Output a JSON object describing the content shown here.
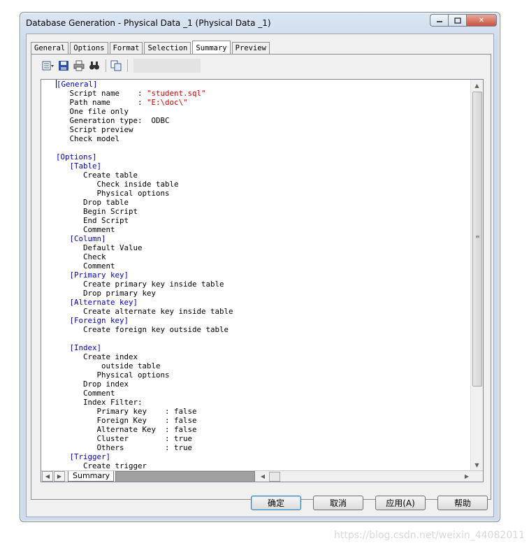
{
  "window": {
    "title": "Database Generation - Physical Data _1 (Physical Data _1)",
    "close_glyph": "✕"
  },
  "tabs": [
    {
      "label": "General"
    },
    {
      "label": "Options"
    },
    {
      "label": "Format"
    },
    {
      "label": "Selection"
    },
    {
      "label": "Summary",
      "active": true
    },
    {
      "label": "Preview"
    }
  ],
  "toolbar": {
    "icons": [
      "properties-icon",
      "save-icon",
      "print-icon",
      "find-icon",
      "copy-icon"
    ]
  },
  "summary_lines": [
    {
      "text": "[General]",
      "kind": "section",
      "indent": 0
    },
    {
      "text": "Script name    : ",
      "value": "\"student.sql\"",
      "indent": 3
    },
    {
      "text": "Path name      : ",
      "value": "\"E:\\doc\\\"",
      "indent": 3
    },
    {
      "text": "One file only",
      "indent": 3
    },
    {
      "text": "Generation type:  ODBC",
      "indent": 3
    },
    {
      "text": "Script preview",
      "indent": 3
    },
    {
      "text": "Check model",
      "indent": 3
    },
    {
      "text": "",
      "indent": 0
    },
    {
      "text": "[Options]",
      "kind": "section",
      "indent": 0
    },
    {
      "text": "[Table]",
      "kind": "section",
      "indent": 3
    },
    {
      "text": "Create table",
      "indent": 6
    },
    {
      "text": "Check inside table",
      "indent": 9
    },
    {
      "text": "Physical options",
      "indent": 9
    },
    {
      "text": "Drop table",
      "indent": 6
    },
    {
      "text": "Begin Script",
      "indent": 6
    },
    {
      "text": "End Script",
      "indent": 6
    },
    {
      "text": "Comment",
      "indent": 6
    },
    {
      "text": "[Column]",
      "kind": "section",
      "indent": 3
    },
    {
      "text": "Default Value",
      "indent": 6
    },
    {
      "text": "Check",
      "indent": 6
    },
    {
      "text": "Comment",
      "indent": 6
    },
    {
      "text": "[Primary key]",
      "kind": "section",
      "indent": 3
    },
    {
      "text": "Create primary key inside table",
      "indent": 6
    },
    {
      "text": "Drop primary key",
      "indent": 6
    },
    {
      "text": "[Alternate key]",
      "kind": "section",
      "indent": 3
    },
    {
      "text": "Create alternate key inside table",
      "indent": 6
    },
    {
      "text": "[Foreign key]",
      "kind": "section",
      "indent": 3
    },
    {
      "text": "Create foreign key outside table",
      "indent": 6
    },
    {
      "text": "",
      "indent": 0
    },
    {
      "text": "[Index]",
      "kind": "section",
      "indent": 3
    },
    {
      "text": "Create index",
      "indent": 6
    },
    {
      "text": "outside table",
      "indent": 10
    },
    {
      "text": "Physical options",
      "indent": 9
    },
    {
      "text": "Drop index",
      "indent": 6
    },
    {
      "text": "Comment",
      "indent": 6
    },
    {
      "text": "Index Filter:",
      "indent": 6
    },
    {
      "text": "Primary key    : false",
      "indent": 9
    },
    {
      "text": "Foreign Key    : false",
      "indent": 9
    },
    {
      "text": "Alternate Key  : false",
      "indent": 9
    },
    {
      "text": "Cluster        : true",
      "indent": 9
    },
    {
      "text": "Others         : true",
      "indent": 9
    },
    {
      "text": "[Trigger]",
      "kind": "section",
      "indent": 3
    },
    {
      "text": "Create trigger",
      "indent": 6
    }
  ],
  "sheet_tab": {
    "label": "Summary"
  },
  "buttons": {
    "ok": "确定",
    "cancel": "取消",
    "apply": "应用(A)",
    "help": "帮助"
  },
  "watermark": "https://blog.csdn.net/weixin_44082011",
  "colors": {
    "section": "#0000c0",
    "string": "#d00000",
    "close_button": "#c7513e"
  }
}
